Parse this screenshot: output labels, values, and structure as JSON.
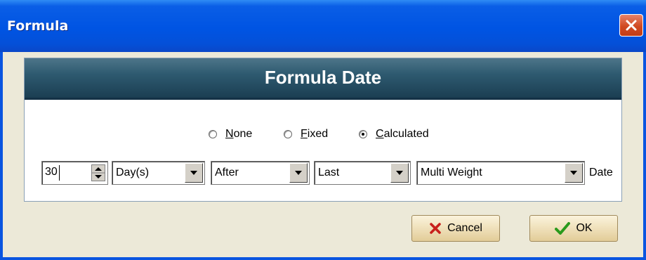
{
  "window": {
    "title": "Formula"
  },
  "panel": {
    "title": "Formula Date"
  },
  "mode": {
    "options": [
      {
        "label": "None",
        "accel": "N",
        "rest": "one",
        "checked": false
      },
      {
        "label": "Fixed",
        "accel": "F",
        "rest": "ixed",
        "checked": false
      },
      {
        "label": "Calculated",
        "accel": "C",
        "rest": "alculated",
        "checked": true
      }
    ]
  },
  "formula": {
    "amount": "30",
    "unit": "Day(s)",
    "relation": "After",
    "which": "Last",
    "event": "Multi Weight",
    "suffix": "Date"
  },
  "buttons": {
    "cancel": "Cancel",
    "ok": "OK"
  },
  "icons": {
    "close": "close-icon",
    "cancel": "red-x-icon",
    "ok": "green-check-icon",
    "spin_up": "spin-up-arrow-icon",
    "spin_down": "spin-down-arrow-icon",
    "dropdown": "chevron-down-icon"
  },
  "colors": {
    "titlebar": "#0054e3",
    "panel_header": "#2e5a70",
    "client_bg": "#ece9d8",
    "close_button": "#d04a22",
    "button_bg": "#efe0ba"
  }
}
